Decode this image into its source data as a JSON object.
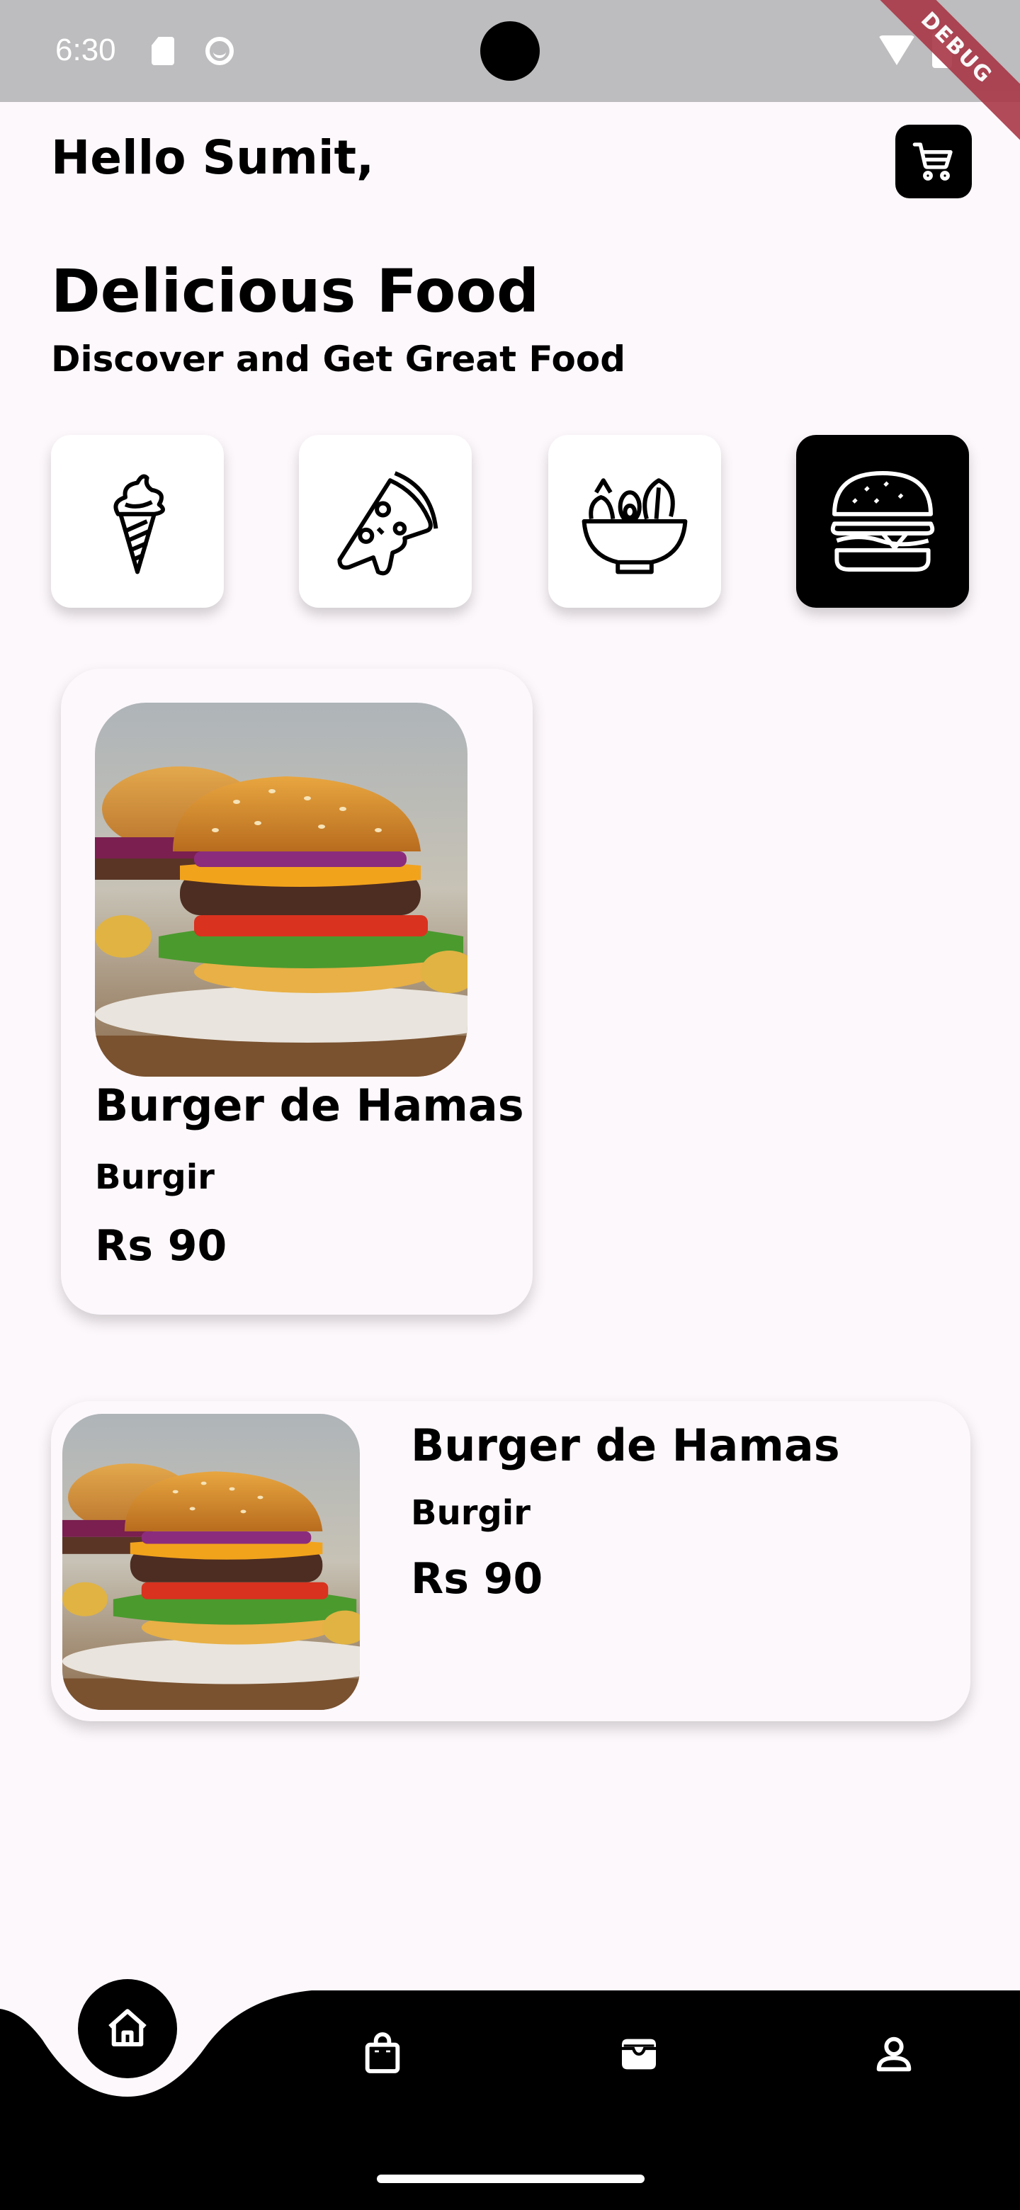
{
  "status_bar": {
    "time": "6:30",
    "debug_label": "DEBUG"
  },
  "header": {
    "greeting": "Hello Sumit,",
    "cart_icon": "cart-icon"
  },
  "hero": {
    "title": "Delicious Food",
    "subtitle": "Discover and Get Great Food"
  },
  "categories": [
    {
      "icon": "ice-cream-icon",
      "active": false
    },
    {
      "icon": "pizza-icon",
      "active": false
    },
    {
      "icon": "salad-icon",
      "active": false
    },
    {
      "icon": "burger-icon",
      "active": true
    }
  ],
  "featured_card": {
    "name": "Burger de Hamas",
    "category": "Burgir",
    "price": "Rs 90"
  },
  "list_card": {
    "name": "Burger de Hamas",
    "category": "Burgir",
    "price": "Rs 90"
  },
  "bottom_nav": [
    {
      "icon": "home-icon",
      "active": true
    },
    {
      "icon": "shopping-bag-icon",
      "active": false
    },
    {
      "icon": "wallet-icon",
      "active": false
    },
    {
      "icon": "profile-icon",
      "active": false
    }
  ],
  "colors": {
    "background": "#fdf8fc",
    "status_bar": "#bdbcbe",
    "accent": "#000000",
    "debug_ribbon": "#a83747"
  }
}
